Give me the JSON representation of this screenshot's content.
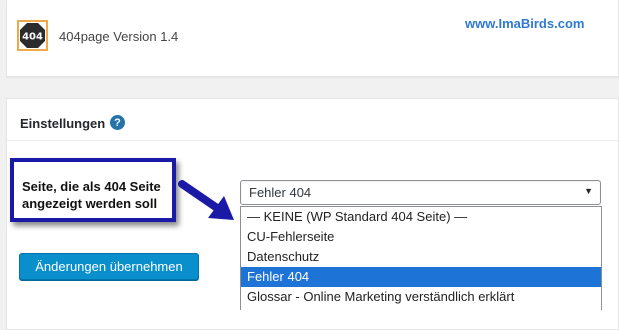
{
  "header": {
    "logo_text": "404",
    "plugin_title": "404page Version 1.4",
    "watermark": "www.ImaBirds.com"
  },
  "settings": {
    "section_title": "Einstellungen",
    "help_icon": "?",
    "callout_line1": "Seite, die als 404 Seite",
    "callout_line2": "angezeigt werden soll",
    "select": {
      "selected_value": "Fehler 404",
      "options": [
        "— KEINE (WP Standard 404 Seite) —",
        "CU-Fehlerseite",
        "Datenschutz",
        "Fehler 404",
        "Glossar - Online Marketing verständlich erklärt"
      ],
      "selected_index": 3
    },
    "save_label": "Änderungen übernehmen"
  },
  "colors": {
    "primary_button": "#0a8fcd",
    "selected_option": "#1e73d6",
    "callout_border": "#1a1aa6",
    "watermark": "#2f7ad1"
  },
  "icons": [
    "octagon-404-icon",
    "help-icon",
    "chevron-down-icon",
    "arrow-icon"
  ]
}
